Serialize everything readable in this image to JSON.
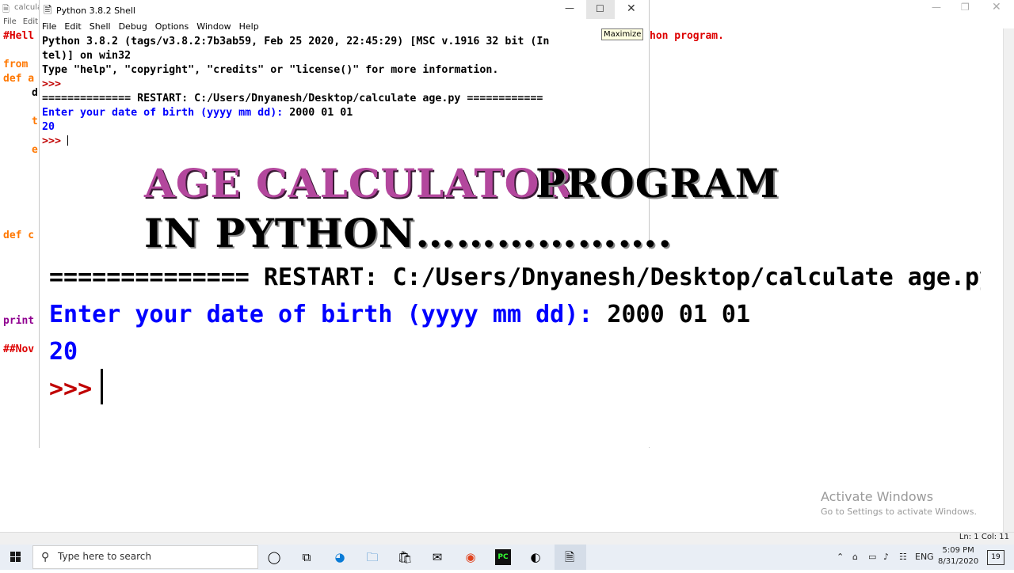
{
  "editor": {
    "title": "calcula",
    "menu": [
      "File",
      "Edit"
    ],
    "code_lines": [
      {
        "text": "#Hell",
        "color": "#dd0000"
      },
      {
        "text": "from ",
        "color": "#ff7700"
      },
      {
        "text": "def a",
        "color": "#ff7700"
      },
      {
        "text": "d",
        "color": "#000000"
      },
      {
        "text": "t",
        "color": "#ff7700"
      },
      {
        "text": "e",
        "color": "#ff7700"
      },
      {
        "text": "def c",
        "color": "#ff7700"
      },
      {
        "text": "print",
        "color": "#900090"
      },
      {
        "text": "##Nov",
        "color": "#dd0000"
      }
    ],
    "right_comment": "hon program.",
    "status": "Ln: 1   Col: 11"
  },
  "shell": {
    "title": "Python 3.8.2 Shell",
    "menu": [
      "File",
      "Edit",
      "Shell",
      "Debug",
      "Options",
      "Window",
      "Help"
    ],
    "tooltip": "Maximize",
    "lines": [
      {
        "text": "Python 3.8.2 (tags/v3.8.2:7b3ab59, Feb 25 2020, 22:45:29) [MSC v.1916 32 bit (In",
        "color": "#000000"
      },
      {
        "text": "tel)] on win32",
        "color": "#000000"
      },
      {
        "text": "Type \"help\", \"copyright\", \"credits\" or \"license()\" for more information.",
        "color": "#000000"
      },
      {
        "text": ">>> ",
        "color": "#c00000"
      },
      {
        "text": "============== RESTART: C:/Users/Dnyanesh/Desktop/calculate age.py ============",
        "color": "#000000"
      },
      {
        "text": "Enter your date of birth (yyyy mm dd): ",
        "color": "#0000ff",
        "input": "2000 01 01"
      },
      {
        "text": "20",
        "color": "#0000ff"
      },
      {
        "text": ">>> ",
        "color": "#c00000"
      }
    ]
  },
  "overlay": {
    "title_colored": "AGE CALCULATOR",
    "title_rest": "PROGRAM",
    "subtitle": "IN PYTHON………………."
  },
  "zoom": {
    "restart": "============== RESTART: C:/Users/Dnyanesh/Desktop/calculate age.py =====",
    "prompt": "Enter your date of birth (yyyy mm dd): ",
    "input": "2000 01 01",
    "output": "20",
    "caret": ">>> "
  },
  "watermark": {
    "line1": "Activate Windows",
    "line2": "Go to Settings to activate Windows."
  },
  "taskbar": {
    "search_placeholder": "Type here to search",
    "lang": "ENG",
    "time": "5:09 PM",
    "date": "8/31/2020",
    "notif_count": "19"
  }
}
